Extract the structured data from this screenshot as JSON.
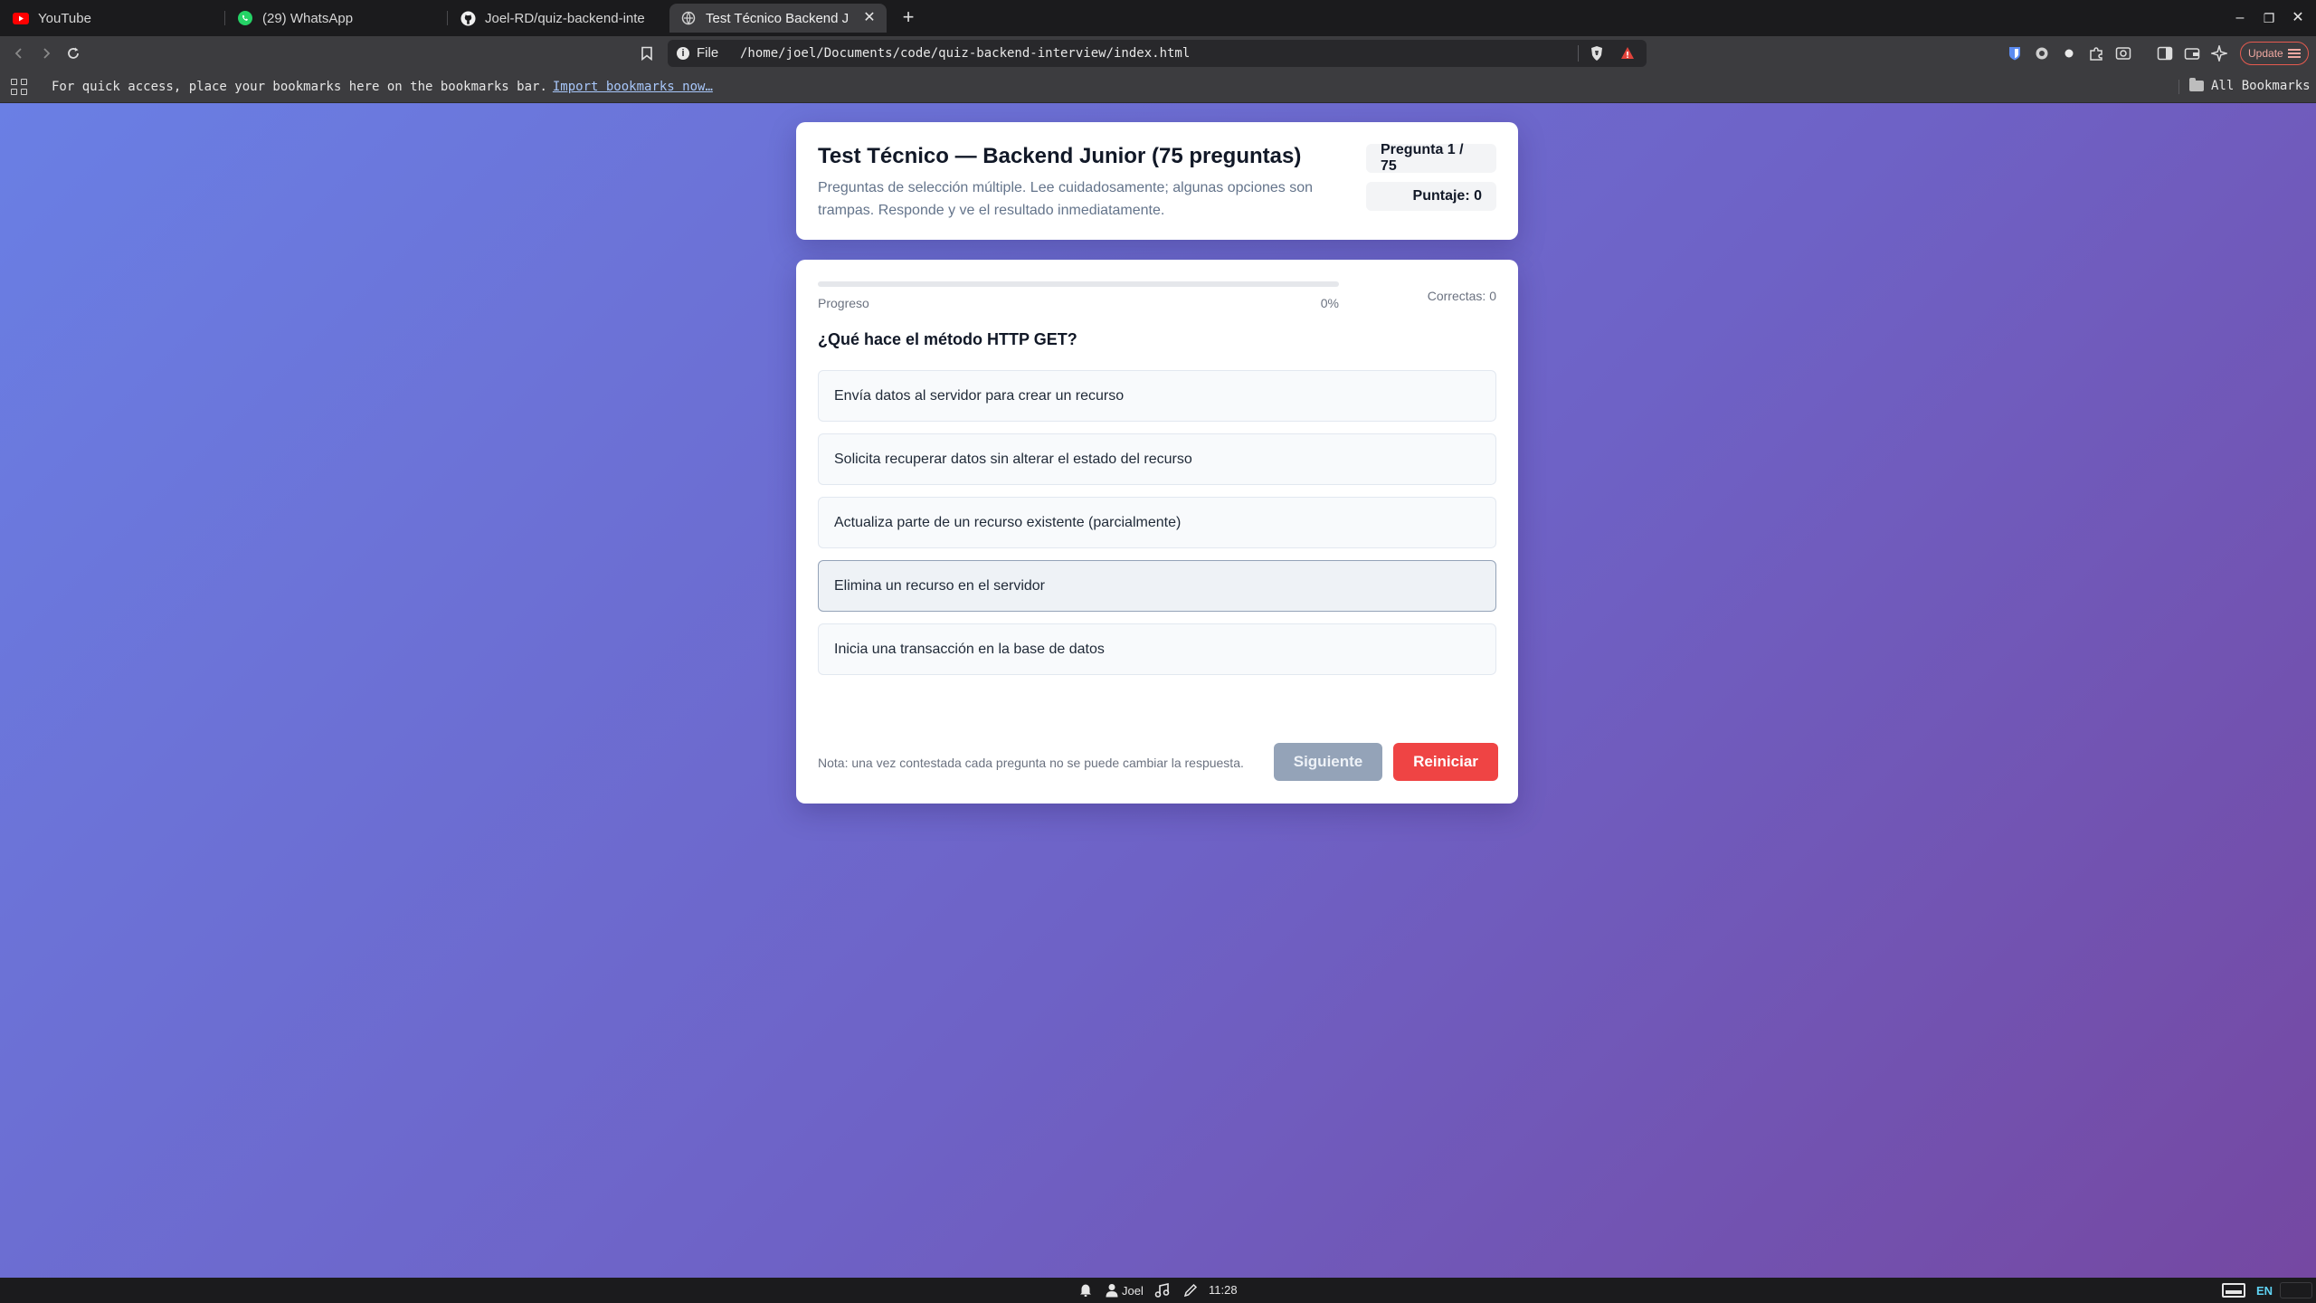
{
  "browser": {
    "tabs": [
      {
        "title": "YouTube",
        "favicon": "youtube-icon",
        "active": false
      },
      {
        "title": "(29) WhatsApp",
        "favicon": "whatsapp-icon",
        "active": false
      },
      {
        "title": "Joel-RD/quiz-backend-inte",
        "favicon": "github-icon",
        "active": false
      },
      {
        "title": "Test Técnico Backend J",
        "favicon": "globe-icon",
        "active": true
      }
    ],
    "address": {
      "scheme_label": "File",
      "url": "/home/joel/Documents/code/quiz-backend-interview/index.html"
    },
    "update_label": "Update",
    "bookmarks_bar": {
      "message": "For quick access, place your bookmarks here on the bookmarks bar.",
      "import_link": "Import bookmarks now…",
      "all_bookmarks": "All Bookmarks"
    }
  },
  "quiz": {
    "title": "Test Técnico — Backend Junior (75 preguntas)",
    "subtitle": "Preguntas de selección múltiple. Lee cuidadosamente; algunas opciones son trampas. Responde y ve el resultado inmediatamente.",
    "question_counter": "Pregunta 1 / 75",
    "score_label": "Puntaje: 0",
    "progress_label": "Progreso",
    "progress_percent_text": "0%",
    "progress_value": 0,
    "correct_label": "Correctas: 0",
    "question": "¿Qué hace el método HTTP GET?",
    "options": [
      "Envía datos al servidor para crear un recurso",
      "Solicita recuperar datos sin alterar el estado del recurso",
      "Actualiza parte de un recurso existente (parcialmente)",
      "Elimina un recurso en el servidor",
      "Inicia una transacción en la base de datos"
    ],
    "note": "Nota: una vez contestada cada pregunta no se puede cambiar la respuesta.",
    "next_button": "Siguiente",
    "reset_button": "Reiniciar"
  },
  "taskbar": {
    "user": "Joel",
    "time": "11:28",
    "lang": "EN"
  },
  "colors": {
    "accent": "#6366f1",
    "danger": "#ef4444",
    "disabled": "#94a3b8",
    "bg_start": "#6a7fe4",
    "bg_end": "#7548a2"
  }
}
